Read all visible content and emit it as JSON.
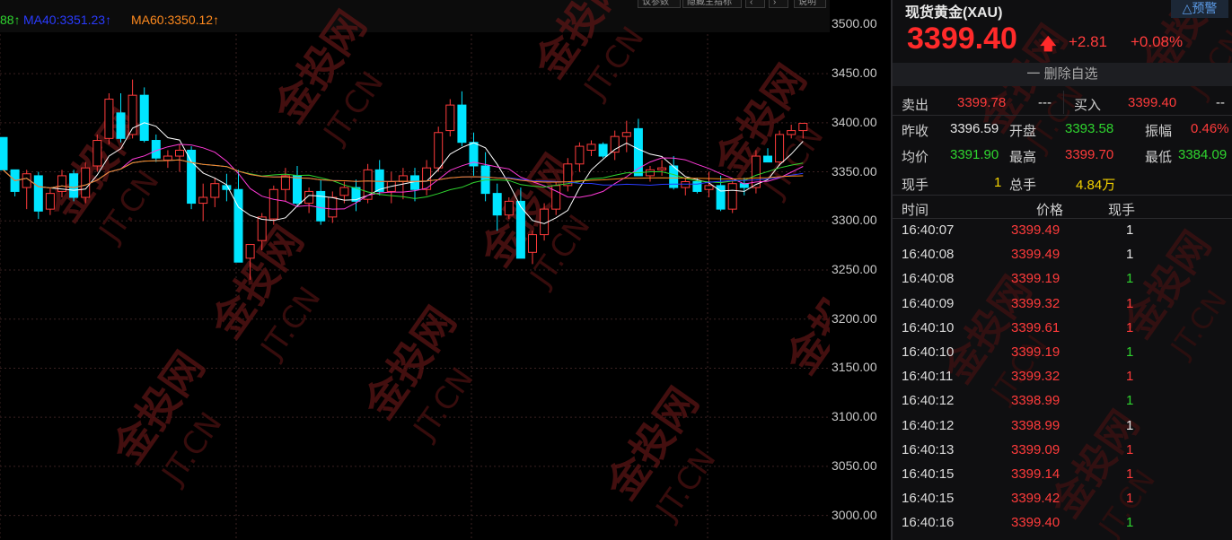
{
  "chart": {
    "ma_legend": [
      {
        "label": "88↑",
        "color": "#2fd52f"
      },
      {
        "label": "MA40:3351.23↑",
        "color": "#2a3bff"
      },
      {
        "label": "MA60:3350.12↑",
        "color": "#ff8a1e"
      }
    ],
    "top_buttons": [
      "议参数",
      "隐藏主指标",
      "‹",
      "›",
      "说明"
    ],
    "y_axis": [
      "3500.00",
      "3450.00",
      "3400.00",
      "3350.00",
      "3300.00",
      "3250.00",
      "3200.00",
      "3150.00",
      "3100.00",
      "3050.00",
      "3000.00"
    ],
    "colors": {
      "up": "#ff3b3b",
      "down": "#00e5ff",
      "grid": "#3a2222"
    }
  },
  "chart_data": {
    "type": "candlestick",
    "y_unit": "USD/oz",
    "ylim": [
      2975,
      3525
    ],
    "candles": [
      [
        3385,
        3385,
        3352,
        3352
      ],
      [
        3352,
        3352,
        3325,
        3330
      ],
      [
        3334,
        3352,
        3312,
        3348
      ],
      [
        3346,
        3350,
        3302,
        3310
      ],
      [
        3312,
        3333,
        3306,
        3328
      ],
      [
        3330,
        3352,
        3324,
        3346
      ],
      [
        3348,
        3352,
        3320,
        3324
      ],
      [
        3324,
        3360,
        3318,
        3354
      ],
      [
        3356,
        3388,
        3350,
        3382
      ],
      [
        3384,
        3430,
        3378,
        3424
      ],
      [
        3410,
        3430,
        3380,
        3384
      ],
      [
        3388,
        3444,
        3384,
        3428
      ],
      [
        3428,
        3436,
        3380,
        3382
      ],
      [
        3382,
        3388,
        3360,
        3364
      ],
      [
        3362,
        3372,
        3354,
        3366
      ],
      [
        3366,
        3378,
        3350,
        3372
      ],
      [
        3372,
        3376,
        3312,
        3318
      ],
      [
        3318,
        3338,
        3300,
        3324
      ],
      [
        3324,
        3344,
        3314,
        3338
      ],
      [
        3336,
        3348,
        3320,
        3332
      ],
      [
        3332,
        3352,
        3258,
        3258
      ],
      [
        3262,
        3276,
        3240,
        3276
      ],
      [
        3280,
        3308,
        3270,
        3304
      ],
      [
        3302,
        3336,
        3296,
        3332
      ],
      [
        3332,
        3354,
        3320,
        3346
      ],
      [
        3346,
        3356,
        3314,
        3318
      ],
      [
        3318,
        3334,
        3308,
        3330
      ],
      [
        3330,
        3342,
        3296,
        3300
      ],
      [
        3304,
        3330,
        3298,
        3324
      ],
      [
        3326,
        3340,
        3318,
        3334
      ],
      [
        3334,
        3342,
        3310,
        3320
      ],
      [
        3322,
        3358,
        3318,
        3352
      ],
      [
        3352,
        3362,
        3326,
        3330
      ],
      [
        3330,
        3350,
        3318,
        3340
      ],
      [
        3340,
        3354,
        3322,
        3346
      ],
      [
        3346,
        3354,
        3320,
        3332
      ],
      [
        3332,
        3362,
        3326,
        3354
      ],
      [
        3354,
        3396,
        3350,
        3390
      ],
      [
        3392,
        3424,
        3386,
        3418
      ],
      [
        3418,
        3432,
        3376,
        3380
      ],
      [
        3380,
        3390,
        3346,
        3356
      ],
      [
        3356,
        3370,
        3320,
        3328
      ],
      [
        3328,
        3338,
        3290,
        3306
      ],
      [
        3306,
        3324,
        3302,
        3320
      ],
      [
        3320,
        3334,
        3262,
        3262
      ],
      [
        3268,
        3290,
        3256,
        3286
      ],
      [
        3286,
        3318,
        3280,
        3312
      ],
      [
        3312,
        3340,
        3306,
        3336
      ],
      [
        3336,
        3364,
        3330,
        3358
      ],
      [
        3358,
        3380,
        3350,
        3376
      ],
      [
        3372,
        3382,
        3366,
        3378
      ],
      [
        3378,
        3380,
        3364,
        3366
      ],
      [
        3370,
        3392,
        3362,
        3386
      ],
      [
        3386,
        3402,
        3370,
        3390
      ],
      [
        3394,
        3404,
        3346,
        3346
      ],
      [
        3346,
        3356,
        3340,
        3352
      ],
      [
        3352,
        3362,
        3346,
        3354
      ],
      [
        3356,
        3366,
        3332,
        3334
      ],
      [
        3334,
        3344,
        3326,
        3340
      ],
      [
        3340,
        3344,
        3328,
        3330
      ],
      [
        3332,
        3350,
        3324,
        3336
      ],
      [
        3336,
        3346,
        3310,
        3312
      ],
      [
        3312,
        3342,
        3308,
        3338
      ],
      [
        3338,
        3344,
        3326,
        3334
      ],
      [
        3334,
        3372,
        3328,
        3366
      ],
      [
        3366,
        3374,
        3360,
        3360
      ],
      [
        3360,
        3392,
        3356,
        3388
      ],
      [
        3388,
        3398,
        3384,
        3392
      ],
      [
        3392,
        3399.7,
        3384,
        3399.4
      ]
    ]
  },
  "quote": {
    "symbol": "现货黄金(XAU)",
    "alert_btn": "△预警",
    "price": "3399.40",
    "change": "+2.81",
    "change_pct": "+0.08%",
    "watchlist_btn": "一 删除自选",
    "sell_label": "卖出",
    "sell_price": "3399.78",
    "sell_vol": "---",
    "buy_label": "买入",
    "buy_price": "3399.40",
    "buy_vol": "--",
    "stats": {
      "prev_close_label": "昨收",
      "prev_close": "3396.59",
      "open_label": "开盘",
      "open": "3393.58",
      "amp_label": "振幅",
      "amp": "0.46%",
      "avg_label": "均价",
      "avg": "3391.90",
      "high_label": "最高",
      "high": "3399.70",
      "low_label": "最低",
      "low": "3384.09",
      "cur_vol_label": "现手",
      "cur_vol": "1",
      "total_vol_label": "总手",
      "total_vol": "4.84万"
    },
    "tick_headers": {
      "time": "时间",
      "price": "价格",
      "vol": "现手"
    },
    "ticks": [
      {
        "time": "16:40:07",
        "price": "3399.49",
        "vol": "1",
        "dir": "white"
      },
      {
        "time": "16:40:08",
        "price": "3399.49",
        "vol": "1",
        "dir": "white"
      },
      {
        "time": "16:40:08",
        "price": "3399.19",
        "vol": "1",
        "dir": "green"
      },
      {
        "time": "16:40:09",
        "price": "3399.32",
        "vol": "1",
        "dir": "red"
      },
      {
        "time": "16:40:10",
        "price": "3399.61",
        "vol": "1",
        "dir": "red"
      },
      {
        "time": "16:40:10",
        "price": "3399.19",
        "vol": "1",
        "dir": "green"
      },
      {
        "time": "16:40:11",
        "price": "3399.32",
        "vol": "1",
        "dir": "red"
      },
      {
        "time": "16:40:12",
        "price": "3398.99",
        "vol": "1",
        "dir": "green"
      },
      {
        "time": "16:40:12",
        "price": "3398.99",
        "vol": "1",
        "dir": "white"
      },
      {
        "time": "16:40:13",
        "price": "3399.09",
        "vol": "1",
        "dir": "red"
      },
      {
        "time": "16:40:15",
        "price": "3399.14",
        "vol": "1",
        "dir": "red"
      },
      {
        "time": "16:40:15",
        "price": "3399.42",
        "vol": "1",
        "dir": "red"
      },
      {
        "time": "16:40:16",
        "price": "3399.40",
        "vol": "1",
        "dir": "green"
      }
    ]
  },
  "watermark": {
    "brand": "金投网",
    "domain": "JT.CN"
  }
}
